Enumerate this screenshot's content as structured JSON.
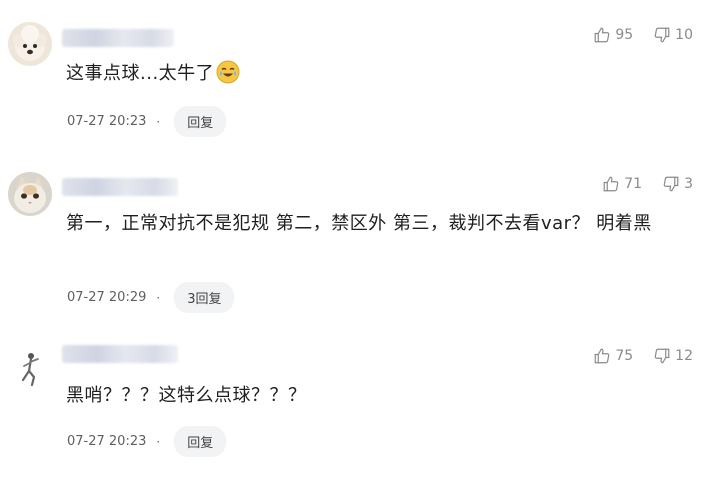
{
  "comments": [
    {
      "avatar": "poodle-avatar",
      "likes": "95",
      "dislikes": "10",
      "text": "这事点球...太牛了",
      "emoji": "crying-laughing-emoji",
      "time": "07-27 20:23",
      "dot": "·",
      "reply_label": "回复"
    },
    {
      "avatar": "cat-avatar",
      "likes": "71",
      "dislikes": "3",
      "text": "第一，正常对抗不是犯规 第二，禁区外 第三，裁判不去看var？ 明着黑",
      "time": "07-27 20:29",
      "dot": "·",
      "reply_label": "3回复"
    },
    {
      "avatar": "figure-avatar",
      "likes": "75",
      "dislikes": "12",
      "text": "黑哨？？？这特么点球？？？",
      "time": "07-27 20:23",
      "dot": "·",
      "reply_label": "回复"
    }
  ]
}
